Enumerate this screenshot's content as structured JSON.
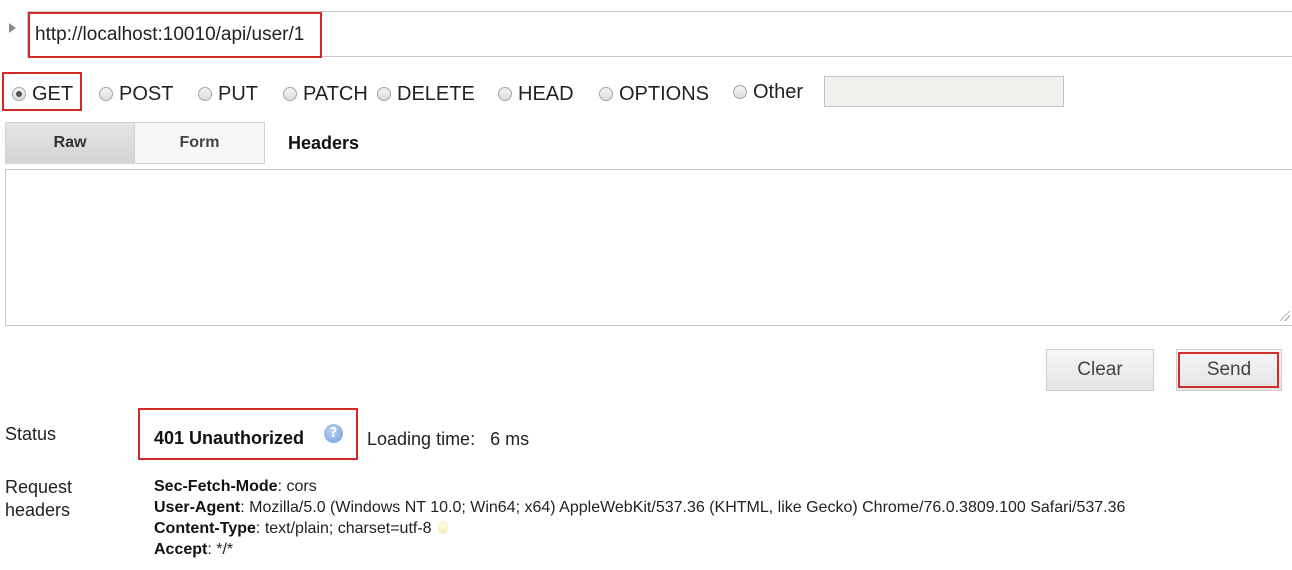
{
  "request": {
    "url": "http://localhost:10010/api/user/1",
    "methods": [
      "GET",
      "POST",
      "PUT",
      "PATCH",
      "DELETE",
      "HEAD",
      "OPTIONS",
      "Other"
    ],
    "selected_method": "GET",
    "other_method_value": "",
    "tabs": [
      "Raw",
      "Form"
    ],
    "active_tab": "Raw",
    "headers_label": "Headers",
    "headers_body": ""
  },
  "actions": {
    "clear_label": "Clear",
    "send_label": "Send"
  },
  "response": {
    "status_label": "Status",
    "status_value": "401 Unauthorized",
    "loading_time_label": "Loading time:",
    "loading_time_value": "6 ms",
    "request_headers_label": [
      "Request",
      "headers"
    ],
    "request_headers": [
      {
        "name": "Sec-Fetch-Mode",
        "value": "cors"
      },
      {
        "name": "User-Agent",
        "value": "Mozilla/5.0 (Windows NT 10.0; Win64; x64) AppleWebKit/537.36 (KHTML, like Gecko) Chrome/76.0.3809.100 Safari/537.36"
      },
      {
        "name": "Content-Type",
        "value": "text/plain; charset=utf-8"
      },
      {
        "name": "Accept",
        "value": "*/*"
      }
    ]
  },
  "icons": {
    "url_toggle": "triangle-right-icon",
    "status_help": "question-mark-icon",
    "content_type_hint": "lightbulb-icon"
  },
  "colors": {
    "highlight_border": "#d32a2a",
    "help_icon": "#6e9bd6"
  }
}
